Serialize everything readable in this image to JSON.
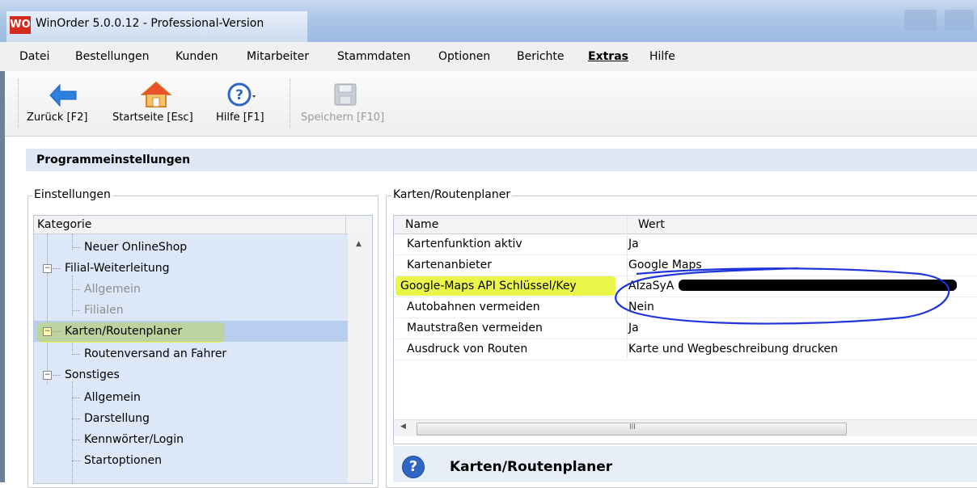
{
  "window": {
    "logo_text": "WO",
    "title": "WinOrder 5.0.0.12 - Professional-Version"
  },
  "menu": {
    "items": [
      "Datei",
      "Bestellungen",
      "Kunden",
      "Mitarbeiter",
      "Stammdaten",
      "Optionen",
      "Berichte",
      "Extras",
      "Hilfe"
    ],
    "active": "Extras"
  },
  "toolbar": {
    "back_label": "Zurück [F2]",
    "home_label": "Startseite [Esc]",
    "help_label": "Hilfe [F1]",
    "save_label": "Speichern [F10]"
  },
  "page": {
    "title": "Programmeinstellungen"
  },
  "settings": {
    "group_label": "Einstellungen",
    "column_header": "Kategorie",
    "items": [
      {
        "label": "Neuer OnlineShop",
        "level": 2,
        "enabled": true
      },
      {
        "label": "Filial-Weiterleitung",
        "level": 1,
        "expander": "minus",
        "enabled": true
      },
      {
        "label": "Allgemein",
        "level": 2,
        "enabled": false
      },
      {
        "label": "Filialen",
        "level": 2,
        "enabled": false
      },
      {
        "label": "Karten/Routenplaner",
        "level": 1,
        "expander": "minus",
        "enabled": true,
        "selected": true
      },
      {
        "label": "Routenversand an Fahrer",
        "level": 2,
        "enabled": true
      },
      {
        "label": "Sonstiges",
        "level": 1,
        "expander": "minus",
        "enabled": true
      },
      {
        "label": "Allgemein",
        "level": 2,
        "enabled": true
      },
      {
        "label": "Darstellung",
        "level": 2,
        "enabled": true
      },
      {
        "label": "Kennwörter/Login",
        "level": 2,
        "enabled": true
      },
      {
        "label": "Startoptionen",
        "level": 2,
        "enabled": true
      }
    ]
  },
  "properties": {
    "group_label": "Karten/Routenplaner",
    "columns": {
      "name": "Name",
      "value": "Wert"
    },
    "rows": [
      {
        "name": "Kartenfunktion aktiv",
        "value": "Ja"
      },
      {
        "name": "Kartenanbieter",
        "value": "Google Maps"
      },
      {
        "name": "Google-Maps API Schlüssel/Key",
        "value": "AIzaSyA"
      },
      {
        "name": "Autobahnen vermeiden",
        "value": "Nein"
      },
      {
        "name": "Mautstraßen vermeiden",
        "value": "Ja"
      },
      {
        "name": "Ausdruck von Routen",
        "value": "Karte und Wegbeschreibung drucken"
      }
    ],
    "scroll_grip": "III"
  },
  "info": {
    "icon_text": "?",
    "title": "Karten/Routenplaner"
  },
  "colors": {
    "highlight": "#e6f528",
    "annotation_circle": "#1f35d8",
    "selection": "#9ab8e8",
    "tree_bg": "#dce8f7",
    "logo_red": "#d42a20"
  }
}
